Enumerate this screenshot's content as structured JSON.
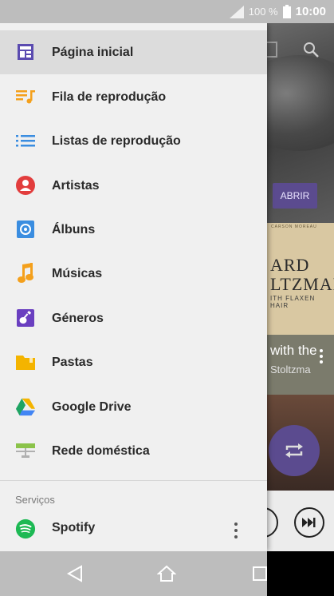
{
  "status_bar": {
    "battery_percent": "100 %",
    "time": "10:00",
    "icons": [
      "signal-icon",
      "battery-icon"
    ]
  },
  "drawer": {
    "items": [
      {
        "label": "Página inicial",
        "icon": "home-icon",
        "active": true
      },
      {
        "label": "Fila de reprodução",
        "icon": "queue-icon"
      },
      {
        "label": "Listas de reprodução",
        "icon": "playlist-icon"
      },
      {
        "label": "Artistas",
        "icon": "artist-icon"
      },
      {
        "label": "Álbuns",
        "icon": "album-icon"
      },
      {
        "label": "Músicas",
        "icon": "music-note-icon"
      },
      {
        "label": "Géneros",
        "icon": "guitar-icon"
      },
      {
        "label": "Pastas",
        "icon": "folder-icon"
      },
      {
        "label": "Google Drive",
        "icon": "google-drive-icon"
      },
      {
        "label": "Rede doméstica",
        "icon": "home-network-icon"
      }
    ],
    "section_label": "Serviços",
    "services": [
      {
        "label": "Spotify",
        "icon": "spotify-icon"
      }
    ]
  },
  "background": {
    "open_button": "ABRIR",
    "album_small": "CARSON MOREAU",
    "album_title_1": "ARD",
    "album_title_2": "LTZMAN",
    "album_sub": "ITH FLAXEN HAIR",
    "song_title": "with the",
    "song_artist": "Stoltzma"
  },
  "colors": {
    "accent": "#5b4b8f",
    "status_bar": "#bdbdbd",
    "drawer_bg": "#f0f0f0",
    "active_item": "#dcdcdc",
    "spotify": "#1db954"
  }
}
